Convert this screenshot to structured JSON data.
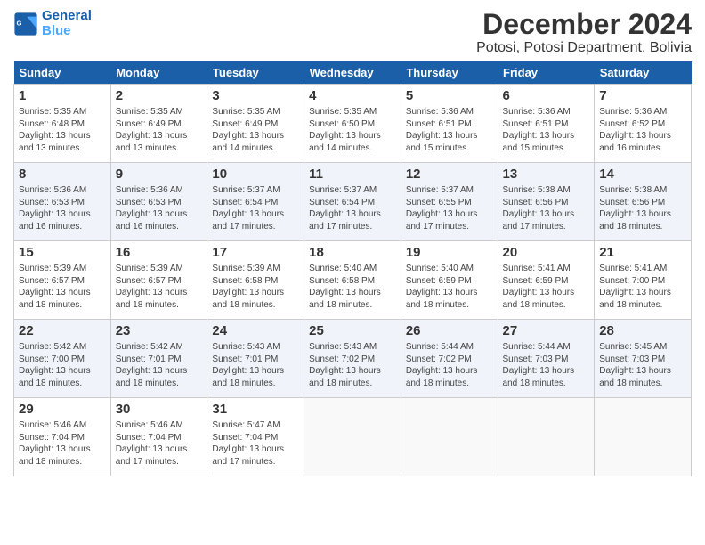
{
  "logo": {
    "line1": "General",
    "line2": "Blue"
  },
  "title": "December 2024",
  "location": "Potosi, Potosi Department, Bolivia",
  "days_of_week": [
    "Sunday",
    "Monday",
    "Tuesday",
    "Wednesday",
    "Thursday",
    "Friday",
    "Saturday"
  ],
  "weeks": [
    [
      {
        "day": "1",
        "sunrise": "5:35 AM",
        "sunset": "6:48 PM",
        "daylight": "13 hours and 13 minutes."
      },
      {
        "day": "2",
        "sunrise": "5:35 AM",
        "sunset": "6:49 PM",
        "daylight": "13 hours and 13 minutes."
      },
      {
        "day": "3",
        "sunrise": "5:35 AM",
        "sunset": "6:49 PM",
        "daylight": "13 hours and 14 minutes."
      },
      {
        "day": "4",
        "sunrise": "5:35 AM",
        "sunset": "6:50 PM",
        "daylight": "13 hours and 14 minutes."
      },
      {
        "day": "5",
        "sunrise": "5:36 AM",
        "sunset": "6:51 PM",
        "daylight": "13 hours and 15 minutes."
      },
      {
        "day": "6",
        "sunrise": "5:36 AM",
        "sunset": "6:51 PM",
        "daylight": "13 hours and 15 minutes."
      },
      {
        "day": "7",
        "sunrise": "5:36 AM",
        "sunset": "6:52 PM",
        "daylight": "13 hours and 16 minutes."
      }
    ],
    [
      {
        "day": "8",
        "sunrise": "5:36 AM",
        "sunset": "6:53 PM",
        "daylight": "13 hours and 16 minutes."
      },
      {
        "day": "9",
        "sunrise": "5:36 AM",
        "sunset": "6:53 PM",
        "daylight": "13 hours and 16 minutes."
      },
      {
        "day": "10",
        "sunrise": "5:37 AM",
        "sunset": "6:54 PM",
        "daylight": "13 hours and 17 minutes."
      },
      {
        "day": "11",
        "sunrise": "5:37 AM",
        "sunset": "6:54 PM",
        "daylight": "13 hours and 17 minutes."
      },
      {
        "day": "12",
        "sunrise": "5:37 AM",
        "sunset": "6:55 PM",
        "daylight": "13 hours and 17 minutes."
      },
      {
        "day": "13",
        "sunrise": "5:38 AM",
        "sunset": "6:56 PM",
        "daylight": "13 hours and 17 minutes."
      },
      {
        "day": "14",
        "sunrise": "5:38 AM",
        "sunset": "6:56 PM",
        "daylight": "13 hours and 18 minutes."
      }
    ],
    [
      {
        "day": "15",
        "sunrise": "5:39 AM",
        "sunset": "6:57 PM",
        "daylight": "13 hours and 18 minutes."
      },
      {
        "day": "16",
        "sunrise": "5:39 AM",
        "sunset": "6:57 PM",
        "daylight": "13 hours and 18 minutes."
      },
      {
        "day": "17",
        "sunrise": "5:39 AM",
        "sunset": "6:58 PM",
        "daylight": "13 hours and 18 minutes."
      },
      {
        "day": "18",
        "sunrise": "5:40 AM",
        "sunset": "6:58 PM",
        "daylight": "13 hours and 18 minutes."
      },
      {
        "day": "19",
        "sunrise": "5:40 AM",
        "sunset": "6:59 PM",
        "daylight": "13 hours and 18 minutes."
      },
      {
        "day": "20",
        "sunrise": "5:41 AM",
        "sunset": "6:59 PM",
        "daylight": "13 hours and 18 minutes."
      },
      {
        "day": "21",
        "sunrise": "5:41 AM",
        "sunset": "7:00 PM",
        "daylight": "13 hours and 18 minutes."
      }
    ],
    [
      {
        "day": "22",
        "sunrise": "5:42 AM",
        "sunset": "7:00 PM",
        "daylight": "13 hours and 18 minutes."
      },
      {
        "day": "23",
        "sunrise": "5:42 AM",
        "sunset": "7:01 PM",
        "daylight": "13 hours and 18 minutes."
      },
      {
        "day": "24",
        "sunrise": "5:43 AM",
        "sunset": "7:01 PM",
        "daylight": "13 hours and 18 minutes."
      },
      {
        "day": "25",
        "sunrise": "5:43 AM",
        "sunset": "7:02 PM",
        "daylight": "13 hours and 18 minutes."
      },
      {
        "day": "26",
        "sunrise": "5:44 AM",
        "sunset": "7:02 PM",
        "daylight": "13 hours and 18 minutes."
      },
      {
        "day": "27",
        "sunrise": "5:44 AM",
        "sunset": "7:03 PM",
        "daylight": "13 hours and 18 minutes."
      },
      {
        "day": "28",
        "sunrise": "5:45 AM",
        "sunset": "7:03 PM",
        "daylight": "13 hours and 18 minutes."
      }
    ],
    [
      {
        "day": "29",
        "sunrise": "5:46 AM",
        "sunset": "7:04 PM",
        "daylight": "13 hours and 18 minutes."
      },
      {
        "day": "30",
        "sunrise": "5:46 AM",
        "sunset": "7:04 PM",
        "daylight": "13 hours and 17 minutes."
      },
      {
        "day": "31",
        "sunrise": "5:47 AM",
        "sunset": "7:04 PM",
        "daylight": "13 hours and 17 minutes."
      },
      null,
      null,
      null,
      null
    ]
  ]
}
